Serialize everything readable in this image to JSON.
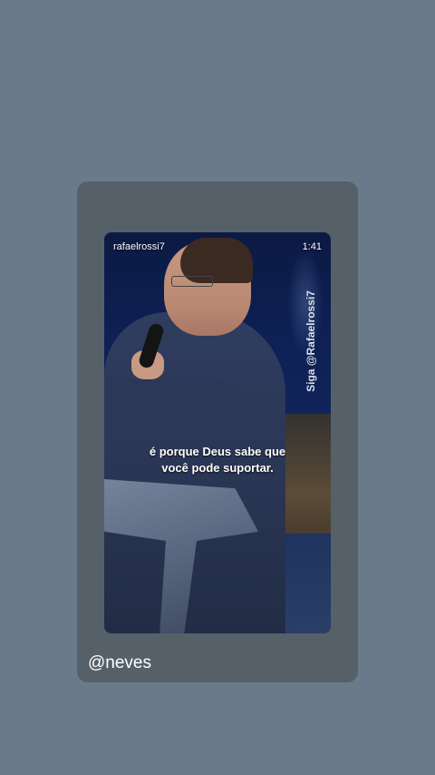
{
  "video": {
    "channel_name": "rafaelrossi7",
    "duration": "1:41",
    "watermark": "Siga @Rafaelrossi7",
    "caption_line1": "é porque Deus sabe que",
    "caption_line2": "você pode suportar."
  },
  "story": {
    "username": "@neves"
  },
  "colors": {
    "page_background": "#6b7a8a",
    "card_background": "#566068"
  }
}
